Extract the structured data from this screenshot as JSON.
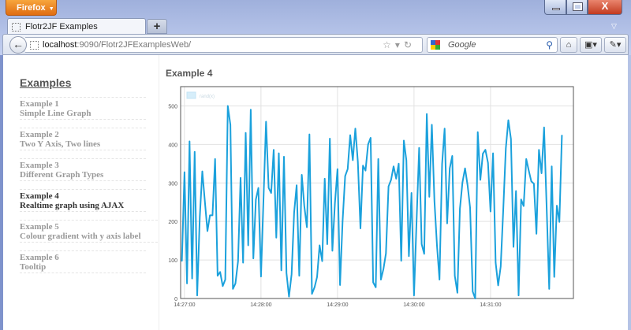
{
  "browser": {
    "app_button": "Firefox",
    "tab_title": "Flotr2JF Examples",
    "new_tab": "+",
    "close_glyph": "X",
    "url_host": "localhost",
    "url_rest": ":9090/Flotr2JFExamplesWeb/",
    "search_placeholder": "Google",
    "icons": [
      "back-icon",
      "star-icon",
      "reload-icon",
      "google-icon",
      "search-icon",
      "home-icon",
      "bookmarks-icon",
      "addon-icon"
    ]
  },
  "sidebar": {
    "title": "Examples",
    "items": [
      {
        "num": "Example 1",
        "label": "Simple Line Graph",
        "active": false
      },
      {
        "num": "Example 2",
        "label": "Two Y Axis, Two lines",
        "active": false
      },
      {
        "num": "Example 3",
        "label": "Different Graph Types",
        "active": false
      },
      {
        "num": "Example 4",
        "label": "Realtime graph using AJAX",
        "active": true
      },
      {
        "num": "Example 5",
        "label": "Colour gradient with y axis label",
        "active": false
      },
      {
        "num": "Example 6",
        "label": "Tooltip",
        "active": false
      }
    ]
  },
  "main": {
    "title": "Example 4"
  },
  "chart_data": {
    "type": "line",
    "legend": {
      "entries": [
        "rand(x)"
      ],
      "placement": "top-left"
    },
    "series": [
      {
        "name": "rand(x)",
        "color": "#1ba1dc",
        "values": [
          97,
          328,
          39,
          408,
          52,
          381,
          8,
          212,
          330,
          253,
          175,
          216,
          216,
          362,
          59,
          69,
          32,
          49,
          500,
          451,
          25,
          39,
          97,
          313,
          93,
          430,
          138,
          490,
          104,
          257,
          287,
          57,
          260,
          459,
          287,
          274,
          386,
          158,
          377,
          73,
          368,
          66,
          5,
          63,
          223,
          294,
          59,
          321,
          240,
          185,
          426,
          12,
          29,
          56,
          138,
          97,
          311,
          141,
          415,
          124,
          247,
          336,
          35,
          199,
          318,
          336,
          424,
          359,
          441,
          355,
          182,
          345,
          332,
          400,
          417,
          42,
          29,
          362,
          49,
          76,
          117,
          291,
          308,
          343,
          311,
          350,
          98,
          410,
          359,
          110,
          274,
          8,
          199,
          391,
          141,
          116,
          479,
          264,
          451,
          253,
          138,
          49,
          349,
          441,
          195,
          338,
          370,
          59,
          15,
          233,
          301,
          338,
          294,
          236,
          18,
          0,
          432,
          308,
          376,
          386,
          352,
          226,
          377,
          93,
          34,
          83,
          233,
          390,
          463,
          414,
          134,
          279,
          8,
          257,
          240,
          362,
          332,
          304,
          298,
          168,
          386,
          325,
          444,
          240,
          25,
          343,
          56,
          241,
          199,
          424
        ]
      }
    ],
    "x_start": "14:26:58",
    "x_interval_seconds": 2,
    "x_ticks": [
      "14:27:00",
      "14:28:00",
      "14:29:00",
      "14:30:00",
      "14:31:00"
    ],
    "y_ticks": [
      0,
      100,
      200,
      300,
      400,
      500
    ],
    "ylim": [
      0,
      550
    ],
    "xlim": [
      "14:26:57",
      "14:32:05"
    ],
    "grid": true
  }
}
